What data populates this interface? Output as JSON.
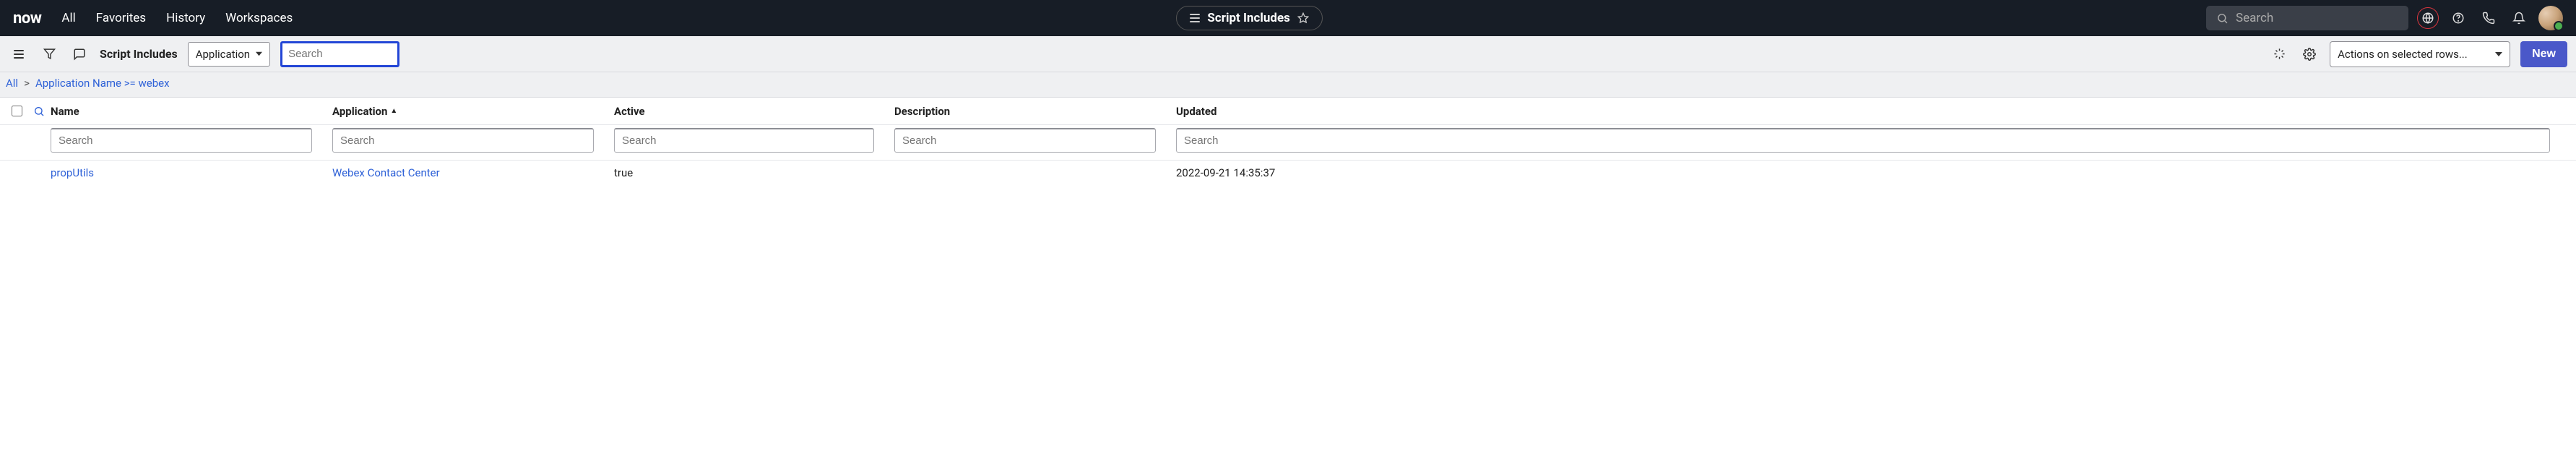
{
  "topbar": {
    "logo_text": "now",
    "nav": {
      "all": "All",
      "favorites": "Favorites",
      "history": "History",
      "workspaces": "Workspaces"
    },
    "context_title": "Script Includes",
    "global_search_placeholder": "Search"
  },
  "toolbar": {
    "title": "Script Includes",
    "filter_field": "Application",
    "search_placeholder": "Search",
    "actions_label": "Actions on selected rows...",
    "new_label": "New"
  },
  "breadcrumb": {
    "all": "All",
    "filter": "Application Name >= webex"
  },
  "columns": {
    "name": "Name",
    "application": "Application",
    "active": "Active",
    "description": "Description",
    "updated": "Updated",
    "search_placeholder": "Search"
  },
  "rows": [
    {
      "name": "propUtils",
      "application": "Webex Contact Center",
      "active": "true",
      "description": "",
      "updated": "2022-09-21 14:35:37"
    }
  ]
}
